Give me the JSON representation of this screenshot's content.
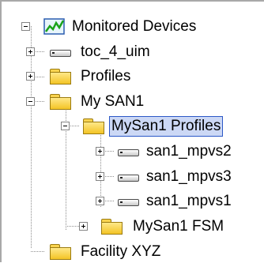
{
  "tree": {
    "root": {
      "label": "Monitored Devices",
      "icon": "monitor-chart-icon",
      "expanded": true
    },
    "items": [
      {
        "label": "toc_4_uim",
        "icon": "device-icon",
        "expanded": false
      },
      {
        "label": "Profiles",
        "icon": "folder-icon",
        "expanded": false
      },
      {
        "label": "My SAN1",
        "icon": "folder-icon",
        "expanded": true
      },
      {
        "label": "MySan1 Profiles",
        "icon": "folder-icon",
        "expanded": true,
        "selected": true
      },
      {
        "label": "san1_mpvs2",
        "icon": "device-icon",
        "expanded": false
      },
      {
        "label": "san1_mpvs3",
        "icon": "device-icon",
        "expanded": false
      },
      {
        "label": "san1_mpvs1",
        "icon": "device-icon",
        "expanded": false
      },
      {
        "label": "MySan1 FSM",
        "icon": "folder-icon",
        "expanded": false
      },
      {
        "label": "Facility XYZ",
        "icon": "folder-icon",
        "expanded": false
      }
    ],
    "colors": {
      "selection_bg": "#ccd8f5",
      "selection_border": "#2c58c7",
      "folder": "#f3c425",
      "chart_line": "#1aa31a"
    }
  }
}
